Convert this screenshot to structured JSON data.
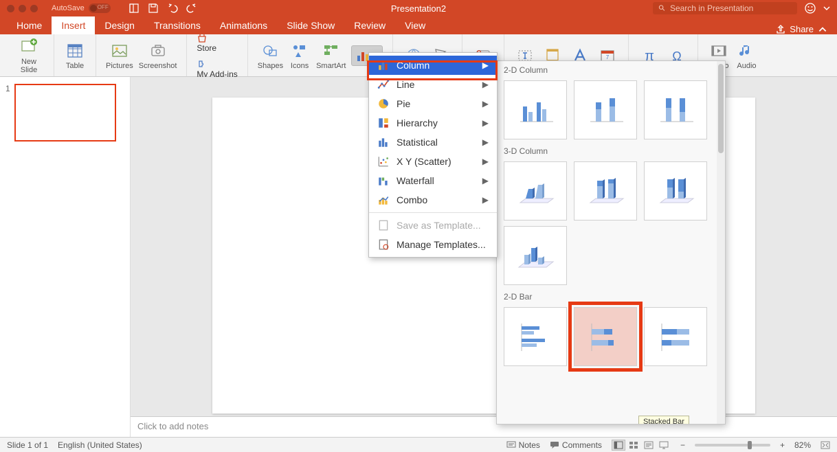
{
  "titlebar": {
    "autosave_label": "AutoSave",
    "document_title": "Presentation2",
    "search_placeholder": "Search in Presentation"
  },
  "tabs": {
    "items": [
      "Home",
      "Insert",
      "Design",
      "Transitions",
      "Animations",
      "Slide Show",
      "Review",
      "View"
    ],
    "active_index": 1,
    "share_label": "Share"
  },
  "ribbon": {
    "new_slide": "New\nSlide",
    "table": "Table",
    "pictures": "Pictures",
    "screenshot": "Screenshot",
    "store": "Store",
    "my_addins": "My Add-ins",
    "shapes": "Shapes",
    "icons": "Icons",
    "smartart": "SmartArt",
    "video": "Video",
    "audio": "Audio"
  },
  "chart_menu": {
    "items": [
      {
        "label": "Column",
        "has_sub": true,
        "selected": true
      },
      {
        "label": "Line",
        "has_sub": true
      },
      {
        "label": "Pie",
        "has_sub": true
      },
      {
        "label": "Hierarchy",
        "has_sub": true
      },
      {
        "label": "Statistical",
        "has_sub": true
      },
      {
        "label": "X Y (Scatter)",
        "has_sub": true
      },
      {
        "label": "Waterfall",
        "has_sub": true
      },
      {
        "label": "Combo",
        "has_sub": true
      }
    ],
    "save_template": "Save as Template...",
    "manage_templates": "Manage Templates..."
  },
  "gallery": {
    "sections": [
      {
        "title": "2-D Column",
        "count": 3
      },
      {
        "title": "3-D Column",
        "count": 4
      },
      {
        "title": "2-D Bar",
        "count": 3
      }
    ],
    "highlighted_tooltip": "Stacked Bar"
  },
  "slide_panel": {
    "thumb_number": "1"
  },
  "notes": {
    "placeholder": "Click to add notes"
  },
  "statusbar": {
    "slide_info": "Slide 1 of 1",
    "language": "English (United States)",
    "notes_label": "Notes",
    "comments_label": "Comments",
    "zoom_pct": "82%"
  },
  "colors": {
    "accent": "#d24726",
    "highlight": "#e63a14",
    "menu_sel": "#2d66d8"
  }
}
